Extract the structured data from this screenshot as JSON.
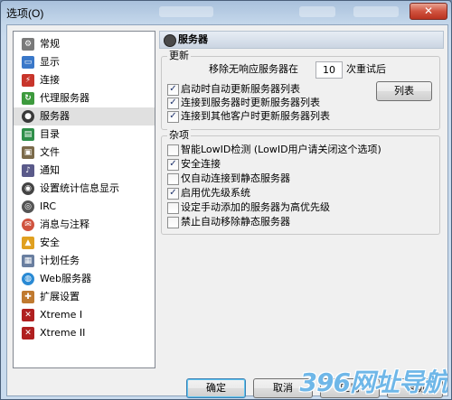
{
  "window": {
    "title": "选项(O)",
    "close_glyph": "✕"
  },
  "sidebar": {
    "items": [
      {
        "label": "常规",
        "icon": "gear-icon",
        "color": "#7a7a7a"
      },
      {
        "label": "显示",
        "icon": "display-icon",
        "color": "#3a78c9"
      },
      {
        "label": "连接",
        "icon": "plug-icon",
        "color": "#c8352b"
      },
      {
        "label": "代理服务器",
        "icon": "proxy-icon",
        "color": "#3d9a3d"
      },
      {
        "label": "服务器",
        "icon": "server-icon",
        "color": "#3a3a3a"
      },
      {
        "label": "目录",
        "icon": "folder-icon",
        "color": "#2f8f4a"
      },
      {
        "label": "文件",
        "icon": "file-icon",
        "color": "#7b6a4a"
      },
      {
        "label": "通知",
        "icon": "notify-icon",
        "color": "#5a5a8a"
      },
      {
        "label": "设置统计信息显示",
        "icon": "stats-icon",
        "color": "#444444"
      },
      {
        "label": "IRC",
        "icon": "irc-icon",
        "color": "#555555"
      },
      {
        "label": "消息与注释",
        "icon": "messages-icon",
        "color": "#d0533f"
      },
      {
        "label": "安全",
        "icon": "lock-icon",
        "color": "#e0a020"
      },
      {
        "label": "计划任务",
        "icon": "schedule-icon",
        "color": "#6a7fa0"
      },
      {
        "label": "Web服务器",
        "icon": "globe-icon",
        "color": "#2a8ad4"
      },
      {
        "label": "扩展设置",
        "icon": "extension-icon",
        "color": "#c07a30"
      },
      {
        "label": "Xtreme I",
        "icon": "xtreme-icon",
        "color": "#b02020"
      },
      {
        "label": "Xtreme II",
        "icon": "xtreme-icon",
        "color": "#b02020"
      }
    ],
    "selected_index": 4
  },
  "page": {
    "title": "服务器",
    "update_group": {
      "title": "更新",
      "retry_prefix": "移除无响应服务器在",
      "retry_value": "10",
      "retry_suffix": "次重试后",
      "list_button": "列表",
      "options": [
        {
          "label": "启动时自动更新服务器列表",
          "checked": true
        },
        {
          "label": "连接到服务器时更新服务器列表",
          "checked": true
        },
        {
          "label": "连接到其他客户时更新服务器列表",
          "checked": true
        }
      ]
    },
    "misc_group": {
      "title": "杂项",
      "options": [
        {
          "label": "智能LowID检测 (LowID用户请关闭这个选项)",
          "checked": false
        },
        {
          "label": "安全连接",
          "checked": true
        },
        {
          "label": "仅自动连接到静态服务器",
          "checked": false
        },
        {
          "label": "启用优先级系统",
          "checked": true
        },
        {
          "label": "设定手动添加的服务器为高优先级",
          "checked": false
        },
        {
          "label": "禁止自动移除静态服务器",
          "checked": false
        }
      ]
    }
  },
  "footer": {
    "ok": "确定",
    "cancel": "取消",
    "apply": "应用",
    "help": "帮助"
  },
  "watermark": {
    "text": "396网址导航"
  },
  "check_glyph": "✓"
}
